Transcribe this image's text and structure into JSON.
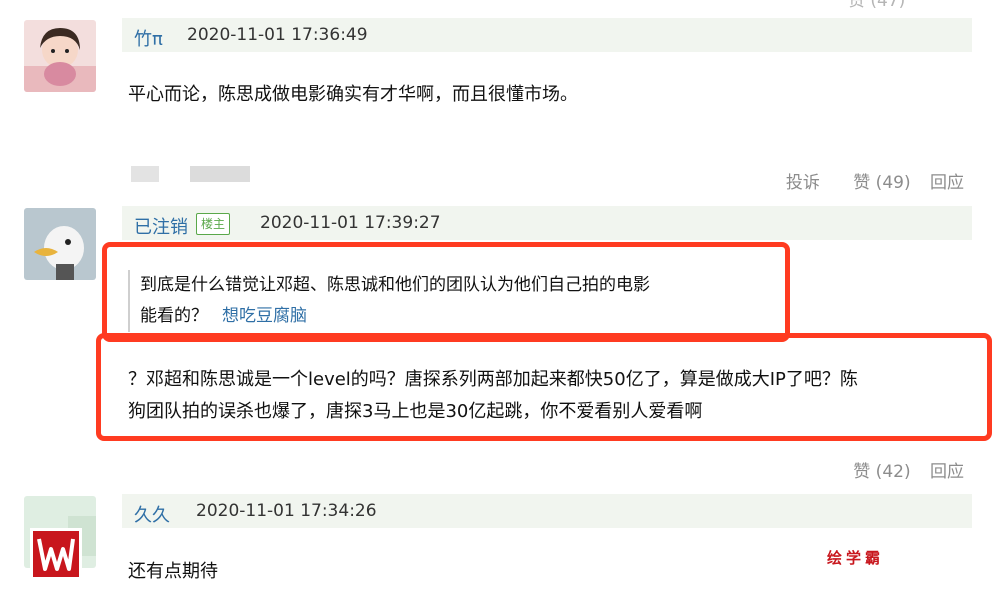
{
  "top_actions": {
    "partial": "..."
  },
  "comments": [
    {
      "username": "竹π",
      "timestamp": "2020-11-01 17:36:49",
      "text": "平心而论，陈思成做电影确实有才华啊，而且很懂市场。",
      "actions": {
        "report": "投诉",
        "like": "赞 (49)",
        "reply": "回应"
      }
    },
    {
      "username": "已注销",
      "owner_badge": "楼主",
      "timestamp": "2020-11-01 17:39:27",
      "quote": {
        "line1": "到底是什么错觉让邓超、陈思诚和他们的团队认为他们自己拍的电影",
        "line2": "能看的？",
        "author": "想吃豆腐脑"
      },
      "text_line1": "？邓超和陈思诚是一个level的吗？唐探系列两部加起来都快50亿了，算是做成大IP了吧？陈",
      "text_line2": "狗团队拍的误杀也爆了，唐探3马上也是30亿起跳，你不爱看别人爱看啊",
      "actions": {
        "like": "赞 (42)",
        "reply": "回应"
      }
    },
    {
      "username": "久久",
      "timestamp": "2020-11-01 17:34:26",
      "text": "还有点期待"
    }
  ],
  "watermark": {
    "text": "绘学霸"
  },
  "colors": {
    "highlight": "#ff3b21",
    "username": "#2f6fa6",
    "meta_bg": "#f1f5ef",
    "action": "#8c8c8c"
  }
}
